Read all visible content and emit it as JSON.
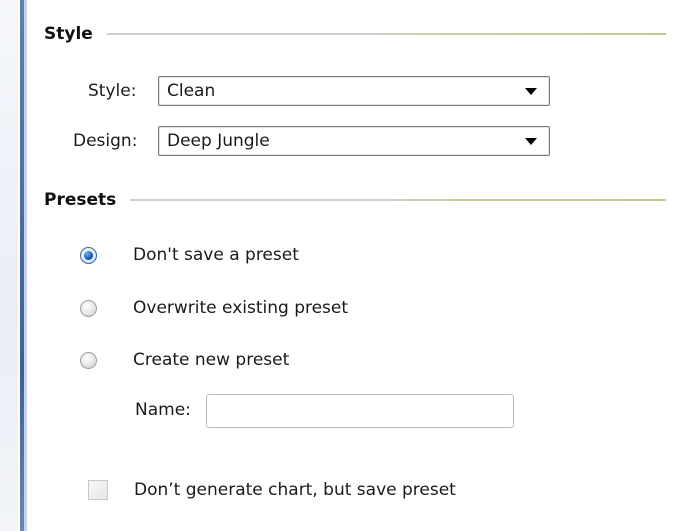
{
  "style_section": {
    "title": "Style",
    "style_label": "Style:",
    "style_value": "Clean",
    "design_label": "Design:",
    "design_value": "Deep Jungle"
  },
  "presets_section": {
    "title": "Presets",
    "options": [
      {
        "label": "Don't save a preset",
        "checked": true
      },
      {
        "label": "Overwrite existing preset",
        "checked": false
      },
      {
        "label": "Create new preset",
        "checked": false
      }
    ],
    "name_label": "Name:",
    "name_value": "",
    "checkbox_label": "Don’t generate chart, but save preset",
    "checkbox_checked": false
  },
  "colors": {
    "accent_blue": "#3e5f93",
    "radio_selected": "#1f5fb3",
    "rule_green": "#c2c88f"
  }
}
